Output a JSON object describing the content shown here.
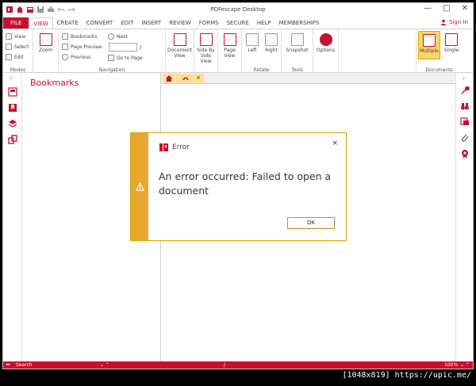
{
  "window": {
    "title": "PDFescape Desktop",
    "signin": "Sign In",
    "minimize": "—",
    "restore": "□",
    "close": "✕"
  },
  "menu": {
    "tabs": [
      "FILE",
      "VIEW",
      "CREATE",
      "CONVERT",
      "EDIT",
      "INSERT",
      "REVIEW",
      "FORMS",
      "SECURE",
      "HELP",
      "MEMBERSHIPS"
    ],
    "active": "VIEW"
  },
  "ribbon": {
    "modes": {
      "items": [
        "View",
        "Select",
        "Edit"
      ],
      "label": "Modes"
    },
    "zoom": "Zoom",
    "navigation": {
      "bookmarks": "Bookmarks",
      "page_preview": "Page Preview",
      "previous": "Previous",
      "next": "Next",
      "goto": "Go to Page",
      "page_sep": "/",
      "label": "Navigation"
    },
    "document_view": [
      "Document",
      "View"
    ],
    "side_by_side": [
      "Side By",
      "Side",
      "View"
    ],
    "page_view": [
      "Page",
      "View"
    ],
    "rotate": {
      "left": "Left",
      "right": "Right",
      "label": "Rotate"
    },
    "tools": {
      "snapshot": "Snapshot",
      "label": "Tools"
    },
    "options": "Options",
    "documents": {
      "multiple": "Multiple",
      "single": "Single",
      "label": "Documents"
    }
  },
  "bookmarks": {
    "title": "Bookmarks"
  },
  "statusbar": {
    "search": "Search",
    "zoom": "100%",
    "page_sep": "/"
  },
  "dialog": {
    "title": "Error",
    "message": "An error occurred: Failed to open a document",
    "ok": "OK",
    "close": "×"
  },
  "watermark": "[1048x819] https://upic.me/",
  "colors": {
    "brand": "#c8102e",
    "warning": "#e6a82e",
    "selected": "#fbd66a"
  }
}
